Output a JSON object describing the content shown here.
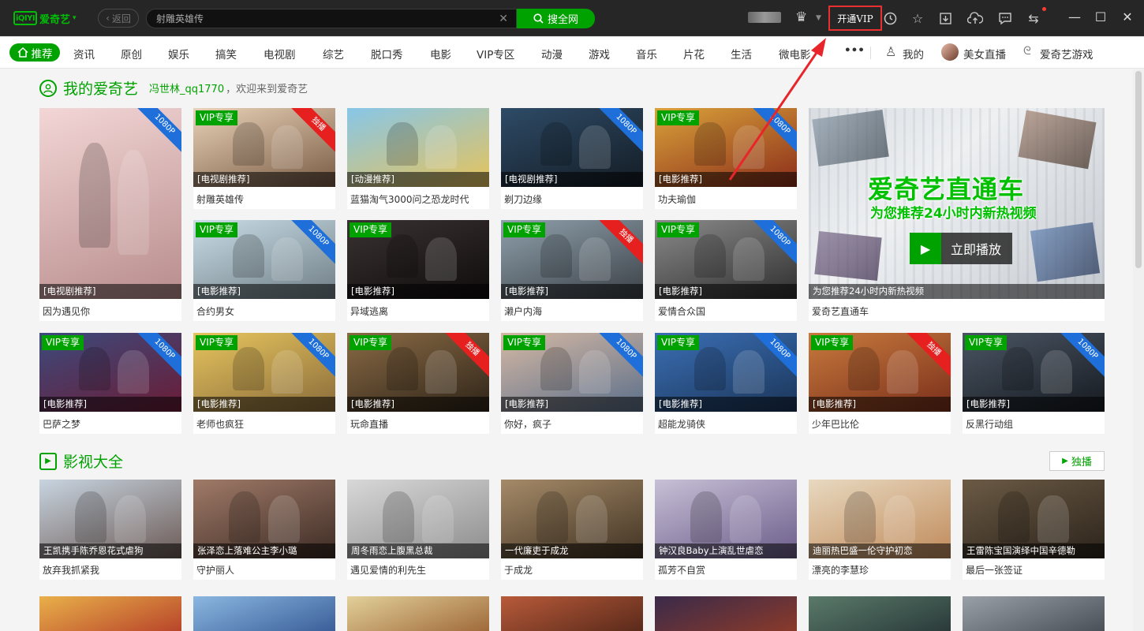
{
  "app": {
    "logo_mark": "iQIYI",
    "logo_text": "爱奇艺",
    "logo_caret": "▾",
    "back_label": "返回",
    "search_value": "射雕英雄传",
    "search_button": "搜全网",
    "vip_button": "开通VIP"
  },
  "nav": {
    "active": "推荐",
    "items": [
      "资讯",
      "原创",
      "娱乐",
      "搞笑",
      "电视剧",
      "综艺",
      "脱口秀",
      "电影",
      "VIP专区",
      "动漫",
      "游戏",
      "音乐",
      "片花",
      "生活",
      "微电影"
    ],
    "more": "•••",
    "mine": "我的",
    "live": "美女直播",
    "games": "爱奇艺游戏"
  },
  "section1": {
    "title": "我的爱奇艺",
    "username": "冯世林_qq1770",
    "welcome": "，欢迎来到爱奇艺"
  },
  "labels": {
    "vip": "VIP专享",
    "exclusive": "独播",
    "hd": "1080P"
  },
  "cards": [
    {
      "tag": "[电视剧推荐]",
      "title": "因为遇见你",
      "vip": false,
      "ribbon": "1080P",
      "rcolor": "blue",
      "c1": "#f3d6d6",
      "c2": "#b88c8c"
    },
    {
      "tag": "[电视剧推荐]",
      "title": "射雕英雄传",
      "vip": true,
      "ribbon": "独播",
      "rcolor": "red",
      "c1": "#e8d2b8",
      "c2": "#7a5b44"
    },
    {
      "tag": "[动漫推荐]",
      "title": "蓝猫淘气3000问之恐龙时代",
      "vip": false,
      "ribbon": "",
      "rcolor": "",
      "c1": "#87c6e8",
      "c2": "#e7c35a"
    },
    {
      "tag": "[电视剧推荐]",
      "title": "剃刀边缘",
      "vip": false,
      "ribbon": "1080P",
      "rcolor": "blue",
      "c1": "#2e4b67",
      "c2": "#141c24"
    },
    {
      "tag": "[电影推荐]",
      "title": "功夫瑜伽",
      "vip": true,
      "ribbon": "1080P",
      "rcolor": "blue",
      "c1": "#d9a23a",
      "c2": "#8c2d1a"
    },
    {
      "tag": "[电影推荐]",
      "title": "合约男女",
      "vip": true,
      "ribbon": "1080P",
      "rcolor": "blue",
      "c1": "#c9dde6",
      "c2": "#6f7d86"
    },
    {
      "tag": "[电影推荐]",
      "title": "异域逃离",
      "vip": true,
      "ribbon": "",
      "rcolor": "",
      "c1": "#3a3232",
      "c2": "#0f0c0c"
    },
    {
      "tag": "[电影推荐]",
      "title": "濑户内海",
      "vip": true,
      "ribbon": "独播",
      "rcolor": "red",
      "c1": "#8ea0ab",
      "c2": "#3c4147"
    },
    {
      "tag": "[电影推荐]",
      "title": "爱情合众国",
      "vip": true,
      "ribbon": "1080P",
      "rcolor": "blue",
      "c1": "#8a8a8a",
      "c2": "#2f2f2f"
    },
    {
      "tag": "[电影推荐]",
      "title": "巴萨之梦",
      "vip": true,
      "ribbon": "1080P",
      "rcolor": "blue",
      "c1": "#3c4a7d",
      "c2": "#6b1c35"
    },
    {
      "tag": "[电影推荐]",
      "title": "老师也疯狂",
      "vip": true,
      "ribbon": "1080P",
      "rcolor": "blue",
      "c1": "#e6c55e",
      "c2": "#8a6b3a"
    },
    {
      "tag": "[电影推荐]",
      "title": "玩命直播",
      "vip": true,
      "ribbon": "独播",
      "rcolor": "red",
      "c1": "#8a6a45",
      "c2": "#2e2418"
    },
    {
      "tag": "[电影推荐]",
      "title": "你好，疯子",
      "vip": true,
      "ribbon": "1080P",
      "rcolor": "blue",
      "c1": "#d5b8a4",
      "c2": "#5b6f8a"
    },
    {
      "tag": "[电影推荐]",
      "title": "超能龙骑侠",
      "vip": true,
      "ribbon": "1080P",
      "rcolor": "blue",
      "c1": "#3b6fb5",
      "c2": "#1b3558"
    },
    {
      "tag": "[电影推荐]",
      "title": "少年巴比伦",
      "vip": true,
      "ribbon": "独播",
      "rcolor": "red",
      "c1": "#c87a3d",
      "c2": "#7a2f1a"
    },
    {
      "tag": "[电影推荐]",
      "title": "反黑行动组",
      "vip": true,
      "ribbon": "1080P",
      "rcolor": "blue",
      "c1": "#4a5563",
      "c2": "#161a20"
    }
  ],
  "promo": {
    "title": "爱奇艺直通车",
    "subtitle": "为您推荐24小时内新热视频",
    "play": "立即播放",
    "caption": "为您推荐24小时内新热视频",
    "name": "爱奇艺直通车"
  },
  "section2": {
    "title": "影视大全",
    "button": "独播"
  },
  "row4": [
    {
      "cap": "王凯携手陈乔恩花式虐狗",
      "title": "放弃我抓紧我",
      "c1": "#c8d4e0",
      "c2": "#6b5a55"
    },
    {
      "cap": "张泽恋上落难公主李小璐",
      "title": "守护丽人",
      "c1": "#a07a68",
      "c2": "#3c2b24"
    },
    {
      "cap": "周冬雨恋上腹黑总裁",
      "title": "遇见爱情的利先生",
      "c1": "#d8d8d8",
      "c2": "#8c8c8c"
    },
    {
      "cap": "一代廉吏于成龙",
      "title": "于成龙",
      "c1": "#a58a68",
      "c2": "#403222"
    },
    {
      "cap": "钟汉良Baby上演乱世虐恋",
      "title": "孤芳不自赏",
      "c1": "#c7c0d6",
      "c2": "#6b5c8a"
    },
    {
      "cap": "迪丽热巴盛一伦守护初恋",
      "title": "漂亮的李慧珍",
      "c1": "#e8d9c0",
      "c2": "#c08a5a"
    },
    {
      "cap": "王雷陈宝国演绎中国辛德勒",
      "title": "最后一张签证",
      "c1": "#6b5a45",
      "c2": "#2b231a"
    }
  ],
  "row5": [
    {
      "c1": "#e9b04a",
      "c2": "#b8452a"
    },
    {
      "c1": "#8ab7e0",
      "c2": "#3b5f9a"
    },
    {
      "c1": "#e2d09a",
      "c2": "#a06a3a"
    },
    {
      "c1": "#b85a3a",
      "c2": "#5a2a1a"
    },
    {
      "c1": "#3a2a4a",
      "c2": "#8a3a2a"
    },
    {
      "c1": "#5a7a6a",
      "c2": "#2a3a3a"
    },
    {
      "c1": "#9aa0a8",
      "c2": "#4a5058"
    },
    {
      "c1": "#e8d0b8",
      "c2": "#6a8ab8"
    }
  ]
}
